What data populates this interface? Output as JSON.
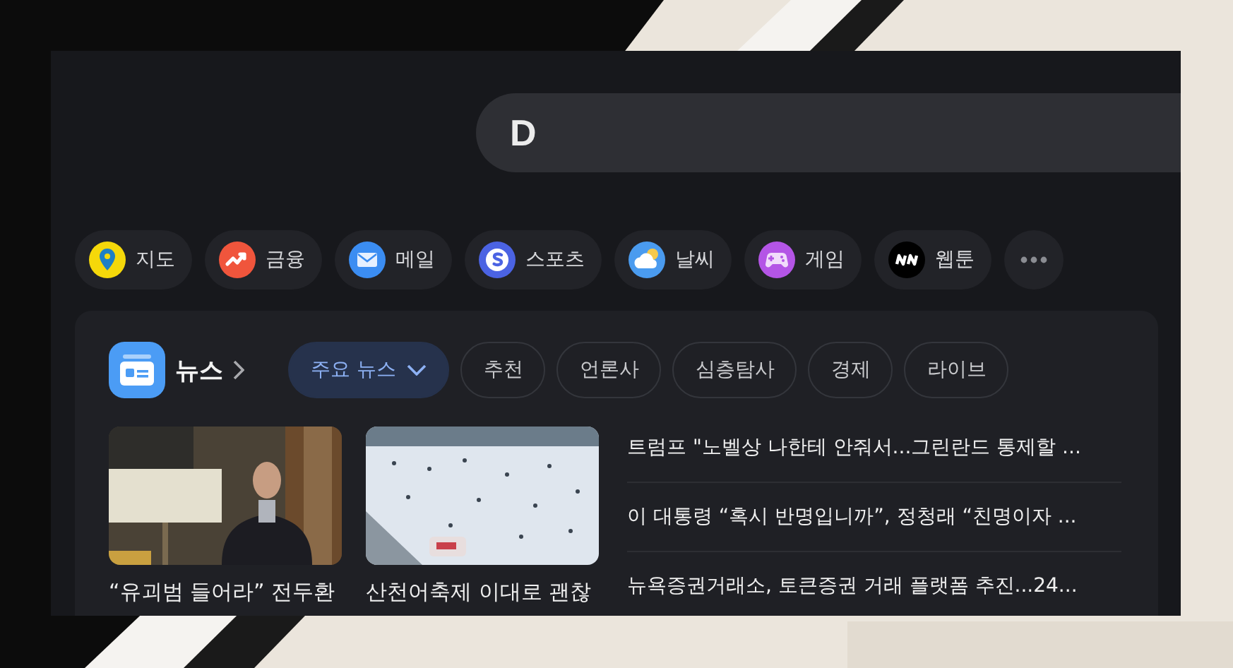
{
  "search": {
    "logo": "D"
  },
  "shortcuts": [
    {
      "kind": "link",
      "label": "지도"
    },
    {
      "kind": "link",
      "label": "금융"
    },
    {
      "kind": "link",
      "label": "메일"
    },
    {
      "kind": "link",
      "label": "스포츠"
    },
    {
      "kind": "link",
      "label": "날씨"
    },
    {
      "kind": "link",
      "label": "게임"
    },
    {
      "kind": "link",
      "label": "웹툰"
    },
    {
      "kind": "more"
    }
  ],
  "news": {
    "title": "뉴스",
    "tabs": [
      {
        "label": "주요 뉴스",
        "selected": true
      },
      {
        "label": "추천",
        "selected": false
      },
      {
        "label": "언론사",
        "selected": false
      },
      {
        "label": "심층탐사",
        "selected": false
      },
      {
        "label": "경제",
        "selected": false
      },
      {
        "label": "라이브",
        "selected": false
      }
    ],
    "photo_stories": [
      {
        "caption": "“유괴범 들어라” 전두환",
        "kind": "picture"
      },
      {
        "caption": "산천어축제 이대로 괜찮",
        "kind": "picture"
      }
    ],
    "headlines": [
      "트럼프 \"노벨상 나한테 안줘서...그린란드 통제할 ...",
      "이 대통령 “혹시 반명입니까”, 정청래 “친명이자 ...",
      "뉴욕증권거래소, 토큰증권 거래 플랫폼 추진...24..."
    ]
  }
}
